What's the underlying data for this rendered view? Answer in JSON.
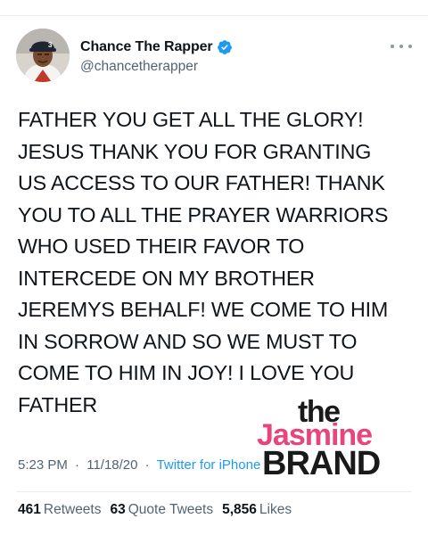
{
  "author": {
    "display_name": "Chance The Rapper",
    "handle": "@chancetherapper",
    "verified": true,
    "avatar": "avatar-photo"
  },
  "tweet": {
    "lines": [
      "FATHER YOU GET ALL THE GLORY!",
      "JESUS THANK YOU FOR GRANTING",
      "US ACCESS TO OUR FATHER! THANK",
      "YOU TO ALL THE PRAYER WARRIORS",
      "WHO USED THEIR FAVOR TO",
      "INTERCEDE ON MY BROTHER",
      "JEREMYS BEHALF! WE COME TO HIM",
      "IN SORROW AND SO WE MUST TO",
      "COME TO HIM IN JOY! I LOVE YOU",
      "FATHER"
    ]
  },
  "meta": {
    "time": "5:23 PM",
    "separator": "·",
    "date": "11/18/20",
    "source": "Twitter for iPhone"
  },
  "stats": {
    "retweets_count": "461",
    "retweets_label": "Retweets",
    "quote_count": "63",
    "quote_label": "Quote Tweets",
    "likes_count": "5,856",
    "likes_label": "Likes"
  },
  "watermark": {
    "line1": "the",
    "line2": "Jasmine",
    "line3": "BRAND"
  },
  "colors": {
    "accent": "#1d9bf0",
    "secondary_text": "#536471",
    "watermark_pink": "#e8457c"
  },
  "icons": {
    "verified": "verified-badge-icon",
    "more": "more-options-icon"
  }
}
